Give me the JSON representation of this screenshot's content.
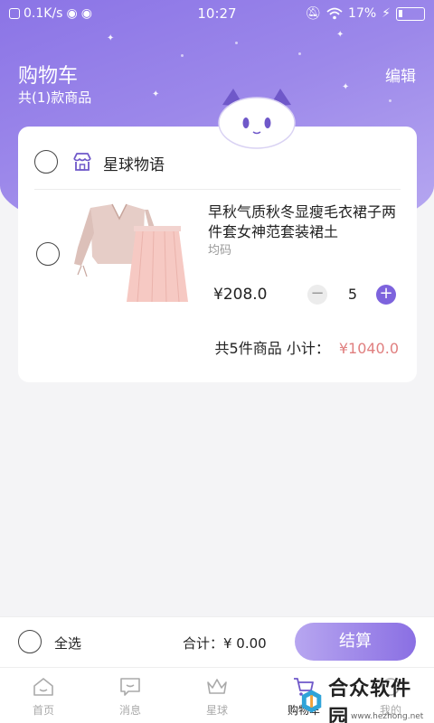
{
  "status_bar": {
    "speed": "0.1K/s",
    "time": "10:27",
    "battery": "17%"
  },
  "header": {
    "title": "购物车",
    "subtitle": "共(1)款商品",
    "edit_label": "编辑"
  },
  "store": {
    "name": "星球物语",
    "selected": false
  },
  "product": {
    "title": "早秋气质秋冬显瘦毛衣裙子两件套女神范套装裙土",
    "spec": "均码",
    "price": "¥208.0",
    "quantity": "5",
    "selected": false
  },
  "subtotal": {
    "label": "共5件商品 小计：",
    "amount": "¥1040.0"
  },
  "checkout": {
    "select_all_label": "全选",
    "total_label": "合计：¥ 0.00",
    "button_label": "结算"
  },
  "tabs": [
    {
      "label": "首页",
      "icon": "home-icon",
      "active": false
    },
    {
      "label": "消息",
      "icon": "message-icon",
      "active": false
    },
    {
      "label": "星球",
      "icon": "crown-icon",
      "active": false
    },
    {
      "label": "购物车",
      "icon": "cart-icon",
      "active": true
    },
    {
      "label": "我的",
      "icon": "profile-icon",
      "active": false
    }
  ],
  "watermark": {
    "text": "合众软件园",
    "url": "www.hezhong.net"
  },
  "colors": {
    "accent": "#7d63dd",
    "price_red": "#e07f7f",
    "header_gradient_start": "#8b74e6",
    "header_gradient_end": "#b9abf1"
  }
}
